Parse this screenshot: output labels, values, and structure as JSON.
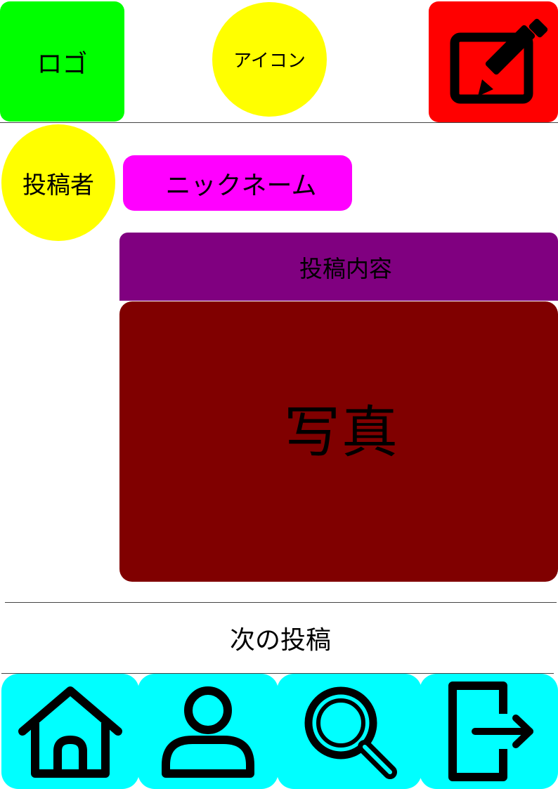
{
  "header": {
    "logo_label": "ロゴ",
    "app_icon_label": "アイコン",
    "compose_icon": "compose-icon"
  },
  "post": {
    "poster_label": "投稿者",
    "nickname_label": "ニックネーム",
    "content_label": "投稿内容",
    "photo_label": "写真"
  },
  "next_post_label": "次の投稿",
  "nav": {
    "items": [
      {
        "icon": "home-icon"
      },
      {
        "icon": "user-icon"
      },
      {
        "icon": "search-icon"
      },
      {
        "icon": "logout-icon"
      }
    ]
  },
  "colors": {
    "logo": "#00ff00",
    "app_icon": "#ffff00",
    "compose_button": "#ff0000",
    "poster_avatar": "#ffff00",
    "nickname": "#ff00ff",
    "post_content": "#800080",
    "photo": "#800000",
    "nav": "#00ffff"
  }
}
